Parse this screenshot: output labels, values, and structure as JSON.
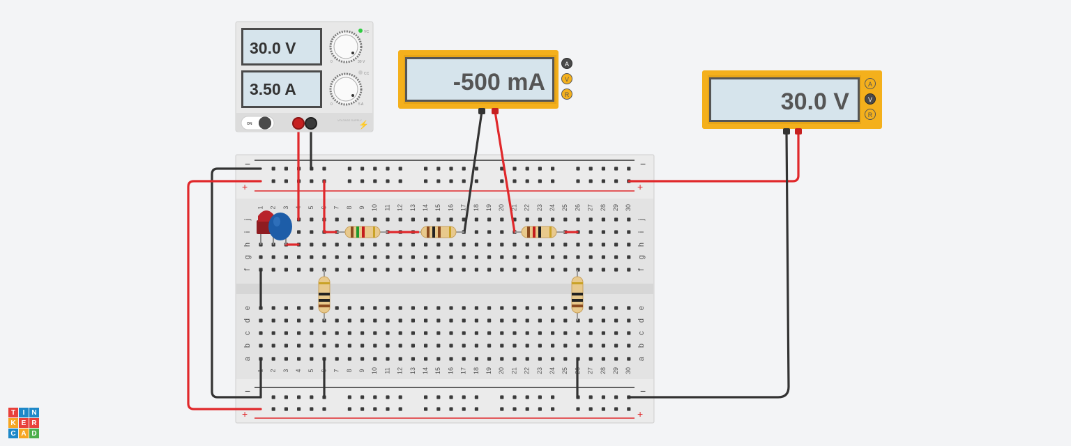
{
  "power_supply": {
    "voltage_display": "30.0 V",
    "current_display": "3.50 A",
    "vc_label": "VC",
    "cc_label": "CC",
    "v_knob_min": "0",
    "v_knob_max": "30 V",
    "a_knob_min": "0",
    "a_knob_max": "5 A",
    "on_label": "ON",
    "brand_label": "VOLTAGE SUPPLY"
  },
  "ammeter": {
    "display": "-500 mA",
    "mode_a": "A",
    "mode_v": "V",
    "mode_r": "R",
    "active_mode": "A"
  },
  "voltmeter": {
    "display": "30.0 V",
    "mode_a": "A",
    "mode_v": "V",
    "mode_r": "R",
    "active_mode": "V"
  },
  "breadboard": {
    "minus_label": "−",
    "plus_label": "+",
    "top_rows": [
      "j",
      "i",
      "h",
      "g",
      "f"
    ],
    "bottom_rows": [
      "e",
      "d",
      "c",
      "b",
      "a"
    ],
    "columns_count": 30
  },
  "logo": {
    "letters": [
      "T",
      "I",
      "N",
      "K",
      "E",
      "R",
      "C",
      "A",
      "D"
    ]
  },
  "colors": {
    "meter_body": "#f4b01c",
    "wire_red": "#e0282b",
    "wire_black": "#333333",
    "led_red": "#b8232a",
    "capacitor_blue": "#1d5da8"
  }
}
